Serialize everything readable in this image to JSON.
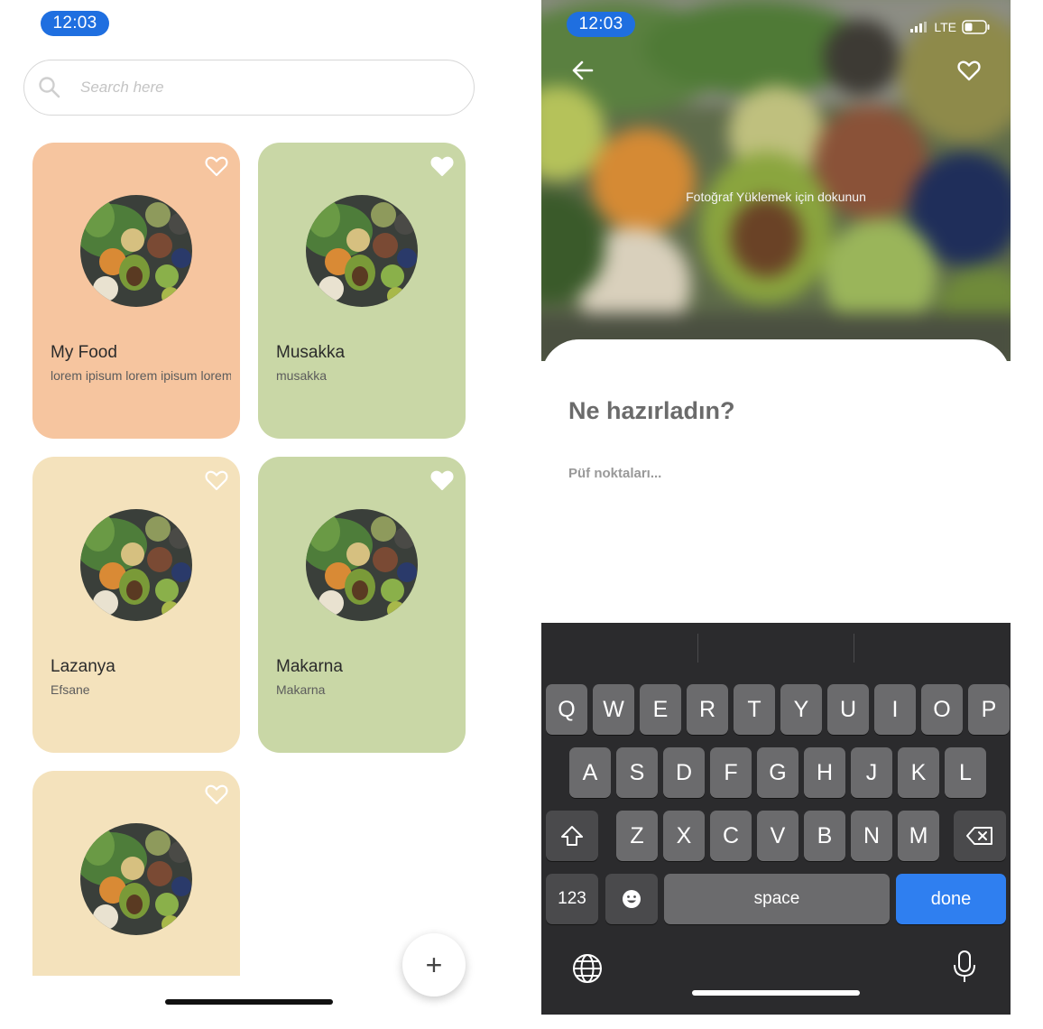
{
  "left_screen": {
    "status": {
      "time": "12:03"
    },
    "search": {
      "placeholder": "Search here"
    },
    "cards": [
      {
        "title": "My Food",
        "subtitle": "lorem ipisum lorem ipisum lorem",
        "bg": "#f6c59f",
        "favorite": false
      },
      {
        "title": "Musakka",
        "subtitle": "musakka",
        "bg": "#c9d7a6",
        "favorite": true
      },
      {
        "title": "Lazanya",
        "subtitle": "Efsane",
        "bg": "#f4e2bc",
        "favorite": false
      },
      {
        "title": "Makarna",
        "subtitle": "Makarna",
        "bg": "#c9d7a6",
        "favorite": true
      },
      {
        "title": "",
        "subtitle": "",
        "bg": "#f4e2bc",
        "favorite": false
      }
    ],
    "fab_label": "+"
  },
  "right_screen": {
    "status": {
      "time": "12:03",
      "network": "LTE"
    },
    "upload_hint": "Fotoğraf Yüklemek için dokunun",
    "question_title": "Ne hazırladın?",
    "tips_placeholder": "Püf noktaları...",
    "keyboard": {
      "row1": [
        "Q",
        "W",
        "E",
        "R",
        "T",
        "Y",
        "U",
        "I",
        "O",
        "P"
      ],
      "row2": [
        "A",
        "S",
        "D",
        "F",
        "G",
        "H",
        "J",
        "K",
        "L"
      ],
      "row3": [
        "Z",
        "X",
        "C",
        "V",
        "B",
        "N",
        "M"
      ],
      "numbers_key": "123",
      "space_key": "space",
      "done_key": "done"
    }
  },
  "colors": {
    "accent": "#1f6fe0",
    "done": "#2f7ff0",
    "keyboard_bg": "#2b2b2d"
  }
}
